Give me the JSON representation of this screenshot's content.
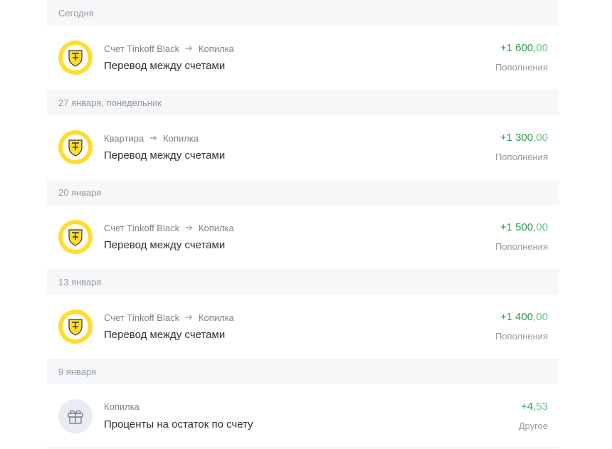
{
  "groups": [
    {
      "date": "Сегодня",
      "operation": {
        "avatar": "tinkoff-logo",
        "from": "Счет Tinkoff Black",
        "to": "Копилка",
        "title": "Перевод между счетами",
        "amount_int": "+1 600",
        "amount_frac": ",00",
        "category": "Пополнения"
      }
    },
    {
      "date": "27 января, понедельник",
      "operation": {
        "avatar": "tinkoff-logo",
        "from": "Квартира",
        "to": "Копилка",
        "title": "Перевод между счетами",
        "amount_int": "+1 300",
        "amount_frac": ",00",
        "category": "Пополнения"
      }
    },
    {
      "date": "20 января",
      "operation": {
        "avatar": "tinkoff-logo",
        "from": "Счет Tinkoff Black",
        "to": "Копилка",
        "title": "Перевод между счетами",
        "amount_int": "+1 500",
        "amount_frac": ",00",
        "category": "Пополнения"
      }
    },
    {
      "date": "13 января",
      "operation": {
        "avatar": "tinkoff-logo",
        "from": "Счет Tinkoff Black",
        "to": "Копилка",
        "title": "Перевод между счетами",
        "amount_int": "+1 400",
        "amount_frac": ",00",
        "category": "Пополнения"
      }
    },
    {
      "date": "9 января",
      "operation": {
        "avatar": "gift-icon",
        "from": "Копилка",
        "to": null,
        "title": "Проценты на остаток по счету",
        "amount_int": "+4",
        "amount_frac": ",53",
        "category": "Другое"
      }
    }
  ],
  "colors": {
    "income": "#2b9a4a",
    "header_bg": "#f6f7f8",
    "tinkoff_yellow": "#ffdd2d"
  }
}
